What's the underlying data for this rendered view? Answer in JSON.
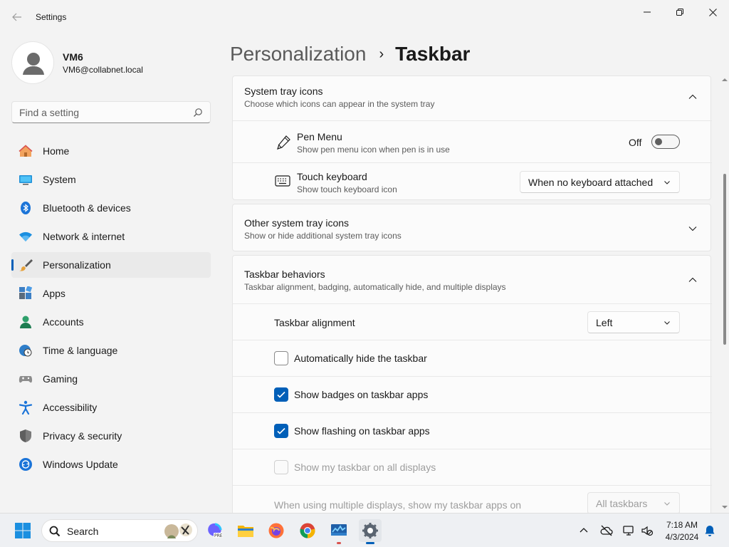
{
  "window": {
    "title": "Settings"
  },
  "user": {
    "name": "VM6",
    "email": "VM6@collabnet.local"
  },
  "search": {
    "placeholder": "Find a setting"
  },
  "nav": {
    "items": [
      {
        "label": "Home",
        "icon": "home-icon"
      },
      {
        "label": "System",
        "icon": "system-icon"
      },
      {
        "label": "Bluetooth & devices",
        "icon": "bluetooth-icon"
      },
      {
        "label": "Network & internet",
        "icon": "wifi-icon"
      },
      {
        "label": "Personalization",
        "icon": "brush-icon",
        "selected": true
      },
      {
        "label": "Apps",
        "icon": "apps-icon"
      },
      {
        "label": "Accounts",
        "icon": "accounts-icon"
      },
      {
        "label": "Time & language",
        "icon": "clock-globe-icon"
      },
      {
        "label": "Gaming",
        "icon": "gamepad-icon"
      },
      {
        "label": "Accessibility",
        "icon": "accessibility-icon"
      },
      {
        "label": "Privacy & security",
        "icon": "shield-icon"
      },
      {
        "label": "Windows Update",
        "icon": "update-icon"
      }
    ]
  },
  "breadcrumb": {
    "parent": "Personalization",
    "separator": "›",
    "current": "Taskbar"
  },
  "system_tray": {
    "title": "System tray icons",
    "description": "Choose which icons can appear in the system tray",
    "pen_menu": {
      "title": "Pen Menu",
      "description": "Show pen menu icon when pen is in use",
      "state": "Off"
    },
    "touch_keyboard": {
      "title": "Touch keyboard",
      "description": "Show touch keyboard icon",
      "value": "When no keyboard attached"
    }
  },
  "other_tray": {
    "title": "Other system tray icons",
    "description": "Show or hide additional system tray icons"
  },
  "behaviors": {
    "title": "Taskbar behaviors",
    "description": "Taskbar alignment, badging, automatically hide, and multiple displays",
    "alignment": {
      "label": "Taskbar alignment",
      "value": "Left"
    },
    "auto_hide": {
      "label": "Automatically hide the taskbar",
      "checked": false
    },
    "badges": {
      "label": "Show badges on taskbar apps",
      "checked": true
    },
    "flashing": {
      "label": "Show flashing on taskbar apps",
      "checked": true
    },
    "all_displays": {
      "label": "Show my taskbar on all displays",
      "checked": false,
      "disabled": true
    },
    "multi_display": {
      "label": "When using multiple displays, show my taskbar apps on",
      "value": "All taskbars",
      "disabled": true
    }
  },
  "taskbar": {
    "search_label": "Search",
    "time": "7:18 AM",
    "date": "4/3/2024"
  },
  "colors": {
    "accent": "#005fb8",
    "background": "#f3f3f3",
    "card": "#fbfbfb"
  }
}
